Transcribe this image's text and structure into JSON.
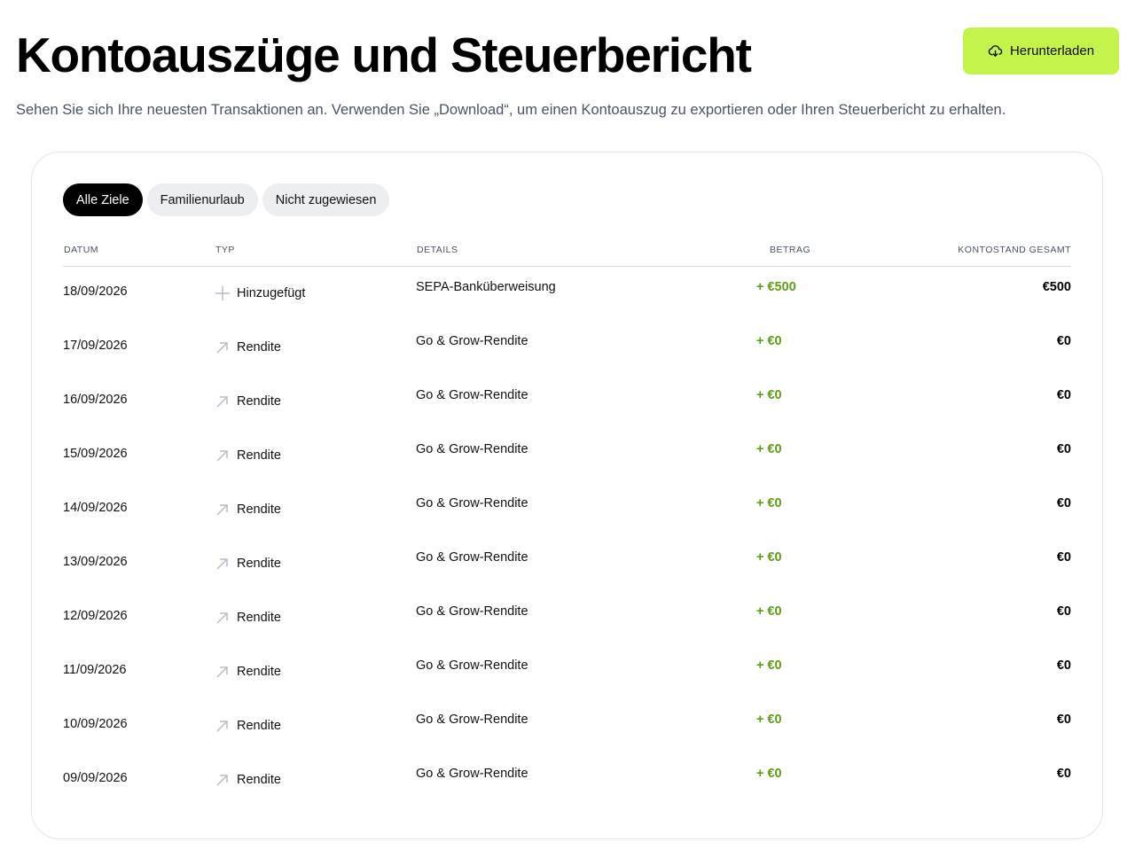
{
  "header": {
    "title": "Kontoauszüge und Steuerbericht",
    "subtitle": "Sehen Sie sich Ihre neuesten Transaktionen an. Verwenden Sie „Download“, um einen Kontoauszug zu exportieren oder Ihren Steuerbericht zu erhalten.",
    "download_label": "Herunterladen",
    "download_icon": "cloud-download-icon"
  },
  "colors": {
    "accent": "#c4f44c",
    "positive_amount": "#5aa012",
    "chip_active_bg": "#000000",
    "chip_bg": "#eceef2",
    "muted_text": "#4a5364"
  },
  "filters": [
    {
      "label": "Alle Ziele",
      "active": true
    },
    {
      "label": "Familienurlaub",
      "active": false
    },
    {
      "label": "Nicht zugewiesen",
      "active": false
    }
  ],
  "table": {
    "columns": {
      "date": "DATUM",
      "type": "TYP",
      "details": "DETAILS",
      "amount": "BETRAG",
      "balance": "KONTOSTAND GESAMT"
    },
    "rows": [
      {
        "date": "18/09/2026",
        "type": "Hinzugefügt",
        "icon": "plus-icon",
        "details": "SEPA-Banküberweisung",
        "amount": "+ €500",
        "balance": "€500"
      },
      {
        "date": "17/09/2026",
        "type": "Rendite",
        "icon": "arrow-up-right-icon",
        "details": "Go & Grow-Rendite",
        "amount": "+ €0",
        "balance": "€0"
      },
      {
        "date": "16/09/2026",
        "type": "Rendite",
        "icon": "arrow-up-right-icon",
        "details": "Go & Grow-Rendite",
        "amount": "+ €0",
        "balance": "€0"
      },
      {
        "date": "15/09/2026",
        "type": "Rendite",
        "icon": "arrow-up-right-icon",
        "details": "Go & Grow-Rendite",
        "amount": "+ €0",
        "balance": "€0"
      },
      {
        "date": "14/09/2026",
        "type": "Rendite",
        "icon": "arrow-up-right-icon",
        "details": "Go & Grow-Rendite",
        "amount": "+ €0",
        "balance": "€0"
      },
      {
        "date": "13/09/2026",
        "type": "Rendite",
        "icon": "arrow-up-right-icon",
        "details": "Go & Grow-Rendite",
        "amount": "+ €0",
        "balance": "€0"
      },
      {
        "date": "12/09/2026",
        "type": "Rendite",
        "icon": "arrow-up-right-icon",
        "details": "Go & Grow-Rendite",
        "amount": "+ €0",
        "balance": "€0"
      },
      {
        "date": "11/09/2026",
        "type": "Rendite",
        "icon": "arrow-up-right-icon",
        "details": "Go & Grow-Rendite",
        "amount": "+ €0",
        "balance": "€0"
      },
      {
        "date": "10/09/2026",
        "type": "Rendite",
        "icon": "arrow-up-right-icon",
        "details": "Go & Grow-Rendite",
        "amount": "+ €0",
        "balance": "€0"
      },
      {
        "date": "09/09/2026",
        "type": "Rendite",
        "icon": "arrow-up-right-icon",
        "details": "Go & Grow-Rendite",
        "amount": "+ €0",
        "balance": "€0"
      }
    ]
  }
}
